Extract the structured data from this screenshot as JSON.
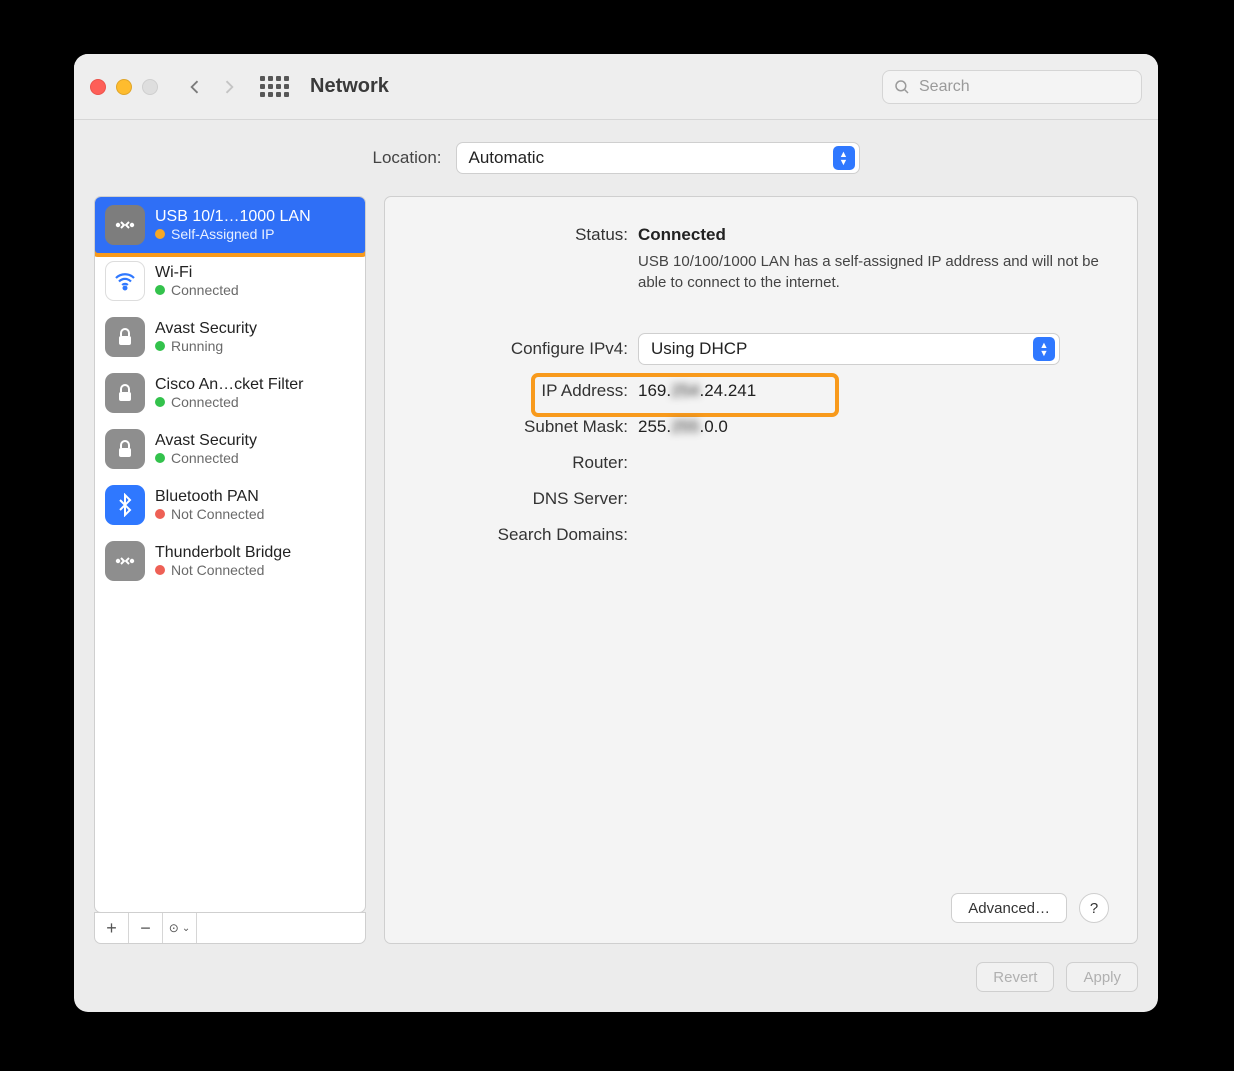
{
  "window": {
    "title": "Network"
  },
  "search": {
    "placeholder": "Search",
    "value": ""
  },
  "location": {
    "label": "Location:",
    "value": "Automatic"
  },
  "sidebar": {
    "items": [
      {
        "title": "USB 10/1…1000 LAN",
        "status": "Self-Assigned IP"
      },
      {
        "title": "Wi-Fi",
        "status": "Connected"
      },
      {
        "title": "Avast Security",
        "status": "Running"
      },
      {
        "title": "Cisco An…cket Filter",
        "status": "Connected"
      },
      {
        "title": "Avast Security",
        "status": "Connected"
      },
      {
        "title": "Bluetooth PAN",
        "status": "Not Connected"
      },
      {
        "title": "Thunderbolt Bridge",
        "status": "Not Connected"
      }
    ]
  },
  "detail": {
    "status_label": "Status:",
    "status_value": "Connected",
    "status_desc": "USB 10/100/1000 LAN has a self-assigned IP address and will not be able to connect to the internet.",
    "config_label": "Configure IPv4:",
    "config_value": "Using DHCP",
    "ip_label": "IP Address:",
    "ip_value_a": "169",
    "ip_value_b": "24.241",
    "ip_blur": "254",
    "subnet_label": "Subnet Mask:",
    "subnet_a": "255.",
    "subnet_b": ".0.0",
    "subnet_blur": "255",
    "router_label": "Router:",
    "dns_label": "DNS Server:",
    "search_domains_label": "Search Domains:",
    "advanced": "Advanced…"
  },
  "footer": {
    "revert": "Revert",
    "apply": "Apply"
  }
}
